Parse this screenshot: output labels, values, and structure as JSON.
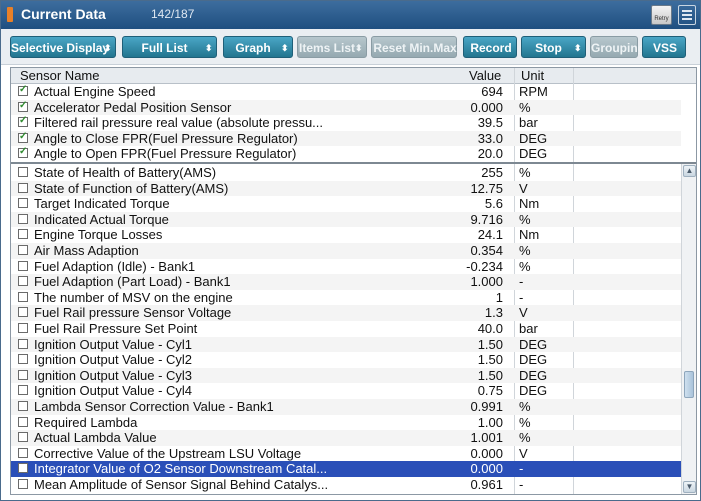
{
  "window": {
    "title": "Current Data",
    "count": "142/187",
    "retry_label": "Retry"
  },
  "toolbar": [
    {
      "label": "Selective Display",
      "dropdown": true,
      "state": "active"
    },
    {
      "label": "Full List",
      "dropdown": true,
      "state": "active"
    },
    {
      "label": "Graph",
      "dropdown": true,
      "state": "active"
    },
    {
      "label": "Items List",
      "dropdown": true,
      "state": "disabled"
    },
    {
      "label": "Reset Min.Max",
      "dropdown": false,
      "state": "disabled"
    },
    {
      "label": "Record",
      "dropdown": false,
      "state": "active"
    },
    {
      "label": "Stop",
      "dropdown": true,
      "state": "active"
    },
    {
      "label": "Grouping",
      "dropdown": false,
      "state": "disabled"
    },
    {
      "label": "VSS",
      "dropdown": false,
      "state": "active"
    }
  ],
  "table": {
    "headers": {
      "name": "Sensor Name",
      "value": "Value",
      "unit": "Unit"
    },
    "pinned_rows": [
      {
        "name": "Actual Engine Speed",
        "value": "694",
        "unit": "RPM",
        "checked": true
      },
      {
        "name": "Accelerator Pedal Position Sensor",
        "value": "0.000",
        "unit": "%",
        "checked": true
      },
      {
        "name": "Filtered rail pressure real value (absolute pressu...",
        "value": "39.5",
        "unit": "bar",
        "checked": true
      },
      {
        "name": "Angle to Close FPR(Fuel Pressure Regulator)",
        "value": "33.0",
        "unit": "DEG",
        "checked": true
      },
      {
        "name": "Angle to Open FPR(Fuel Pressure Regulator)",
        "value": "20.0",
        "unit": "DEG",
        "checked": true
      }
    ],
    "rows": [
      {
        "name": "State of Health of Battery(AMS)",
        "value": "255",
        "unit": "%",
        "checked": false
      },
      {
        "name": "State of Function of Battery(AMS)",
        "value": "12.75",
        "unit": "V",
        "checked": false
      },
      {
        "name": "Target Indicated Torque",
        "value": "5.6",
        "unit": "Nm",
        "checked": false
      },
      {
        "name": "Indicated Actual Torque",
        "value": "9.716",
        "unit": "%",
        "checked": false
      },
      {
        "name": "Engine Torque Losses",
        "value": "24.1",
        "unit": "Nm",
        "checked": false
      },
      {
        "name": "Air Mass Adaption",
        "value": "0.354",
        "unit": "%",
        "checked": false
      },
      {
        "name": "Fuel Adaption (Idle) - Bank1",
        "value": "-0.234",
        "unit": "%",
        "checked": false
      },
      {
        "name": "Fuel Adaption (Part Load) - Bank1",
        "value": "1.000",
        "unit": "-",
        "checked": false
      },
      {
        "name": "The number of MSV on the engine",
        "value": "1",
        "unit": "-",
        "checked": false
      },
      {
        "name": "Fuel Rail pressure Sensor Voltage",
        "value": "1.3",
        "unit": "V",
        "checked": false
      },
      {
        "name": "Fuel Rail Pressure Set Point",
        "value": "40.0",
        "unit": "bar",
        "checked": false
      },
      {
        "name": "Ignition Output Value - Cyl1",
        "value": "1.50",
        "unit": "DEG",
        "checked": false
      },
      {
        "name": "Ignition Output Value - Cyl2",
        "value": "1.50",
        "unit": "DEG",
        "checked": false
      },
      {
        "name": "Ignition Output Value - Cyl3",
        "value": "1.50",
        "unit": "DEG",
        "checked": false
      },
      {
        "name": "Ignition Output Value - Cyl4",
        "value": "0.75",
        "unit": "DEG",
        "checked": false
      },
      {
        "name": "Lambda Sensor Correction Value - Bank1",
        "value": "0.991",
        "unit": "%",
        "checked": false
      },
      {
        "name": "Required Lambda",
        "value": "1.00",
        "unit": "%",
        "checked": false
      },
      {
        "name": "Actual Lambda Value",
        "value": "1.001",
        "unit": "%",
        "checked": false
      },
      {
        "name": "Corrective Value of the Upstream LSU Voltage",
        "value": "0.000",
        "unit": "V",
        "checked": false
      },
      {
        "name": "Integrator Value of O2 Sensor Downstream Catal...",
        "value": "0.000",
        "unit": "-",
        "checked": false,
        "selected": true
      },
      {
        "name": "Mean Amplitude of Sensor Signal Behind Catalys...",
        "value": "0.961",
        "unit": "-",
        "checked": false
      }
    ]
  },
  "icons": {
    "window": "data-icon",
    "retry": "retry-icon",
    "menu": "menu-icon",
    "scroll_up": "arrow-up-icon",
    "scroll_down": "arrow-down-icon",
    "dropdown": "chevron-updown-icon"
  },
  "colors": {
    "titlebar": "#1f4f80",
    "button": "#2a87a6",
    "selection": "#2a4fb8"
  }
}
